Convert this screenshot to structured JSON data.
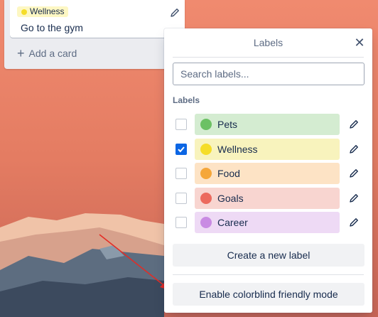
{
  "card": {
    "label": "Wellness",
    "label_color": "#f5dd29",
    "title": "Go to the gym",
    "edit_icon": "pencil-icon"
  },
  "list": {
    "add_card": "Add a card"
  },
  "popover": {
    "title": "Labels",
    "close_icon": "close-icon",
    "search_placeholder": "Search labels...",
    "section_title": "Labels",
    "labels": [
      {
        "name": "Pets",
        "dot_color": "#6cc164",
        "bg_color": "#d4ecd1",
        "checked": false
      },
      {
        "name": "Wellness",
        "dot_color": "#f5dd29",
        "bg_color": "#f8f3bd",
        "checked": true
      },
      {
        "name": "Food",
        "dot_color": "#f5a73a",
        "bg_color": "#fde3c5",
        "checked": false
      },
      {
        "name": "Goals",
        "dot_color": "#ec6a5e",
        "bg_color": "#f8d5d0",
        "checked": false
      },
      {
        "name": "Career",
        "dot_color": "#c98be3",
        "bg_color": "#eedaf5",
        "checked": false
      }
    ],
    "create_label": "Create a new label",
    "colorblind_mode": "Enable colorblind friendly mode"
  }
}
